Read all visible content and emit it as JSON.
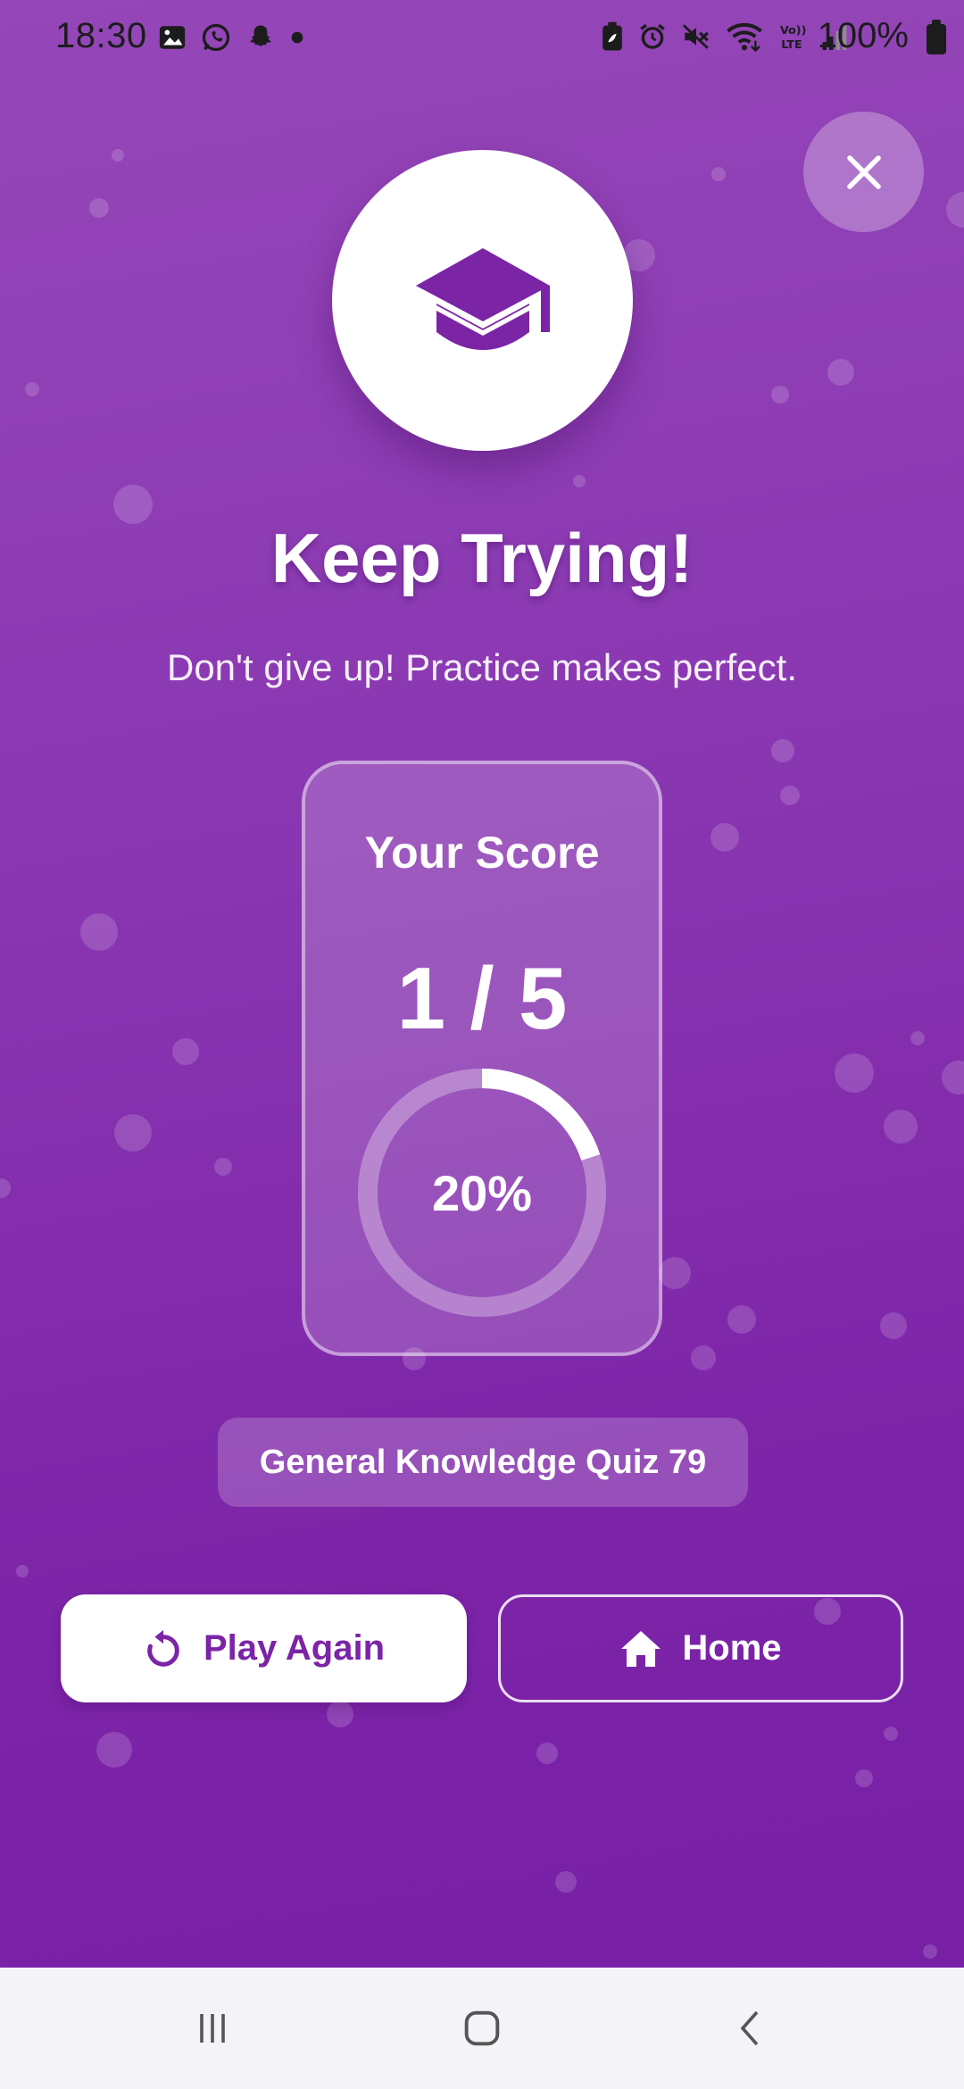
{
  "status_bar": {
    "time": "18:30",
    "battery_percent": "100%",
    "left_icons": [
      "gallery-icon",
      "whatsapp-icon",
      "snapchat-icon",
      "dot-icon"
    ],
    "right_icons": [
      "battery-saver-icon",
      "alarm-icon",
      "mute-icon",
      "wifi-icon",
      "volte-icon",
      "signal-icon"
    ]
  },
  "result": {
    "icon": "graduation-cap-icon",
    "title": "Keep Trying!",
    "message": "Don't give up! Practice makes perfect."
  },
  "score": {
    "label": "Your Score",
    "value": "1 / 5",
    "percent_text": "20%",
    "percent_fraction": 0.2
  },
  "quiz": {
    "name": "General Knowledge Quiz 79"
  },
  "actions": {
    "play_again_label": "Play Again",
    "play_again_icon": "replay-icon",
    "home_label": "Home",
    "home_icon": "home-icon"
  },
  "colors": {
    "accent": "#7b24a6",
    "background_top": "#9547b8",
    "background_bottom": "#7720a6"
  },
  "nav_bar": {
    "buttons": [
      "recent-apps-icon",
      "home-nav-icon",
      "back-icon"
    ]
  }
}
